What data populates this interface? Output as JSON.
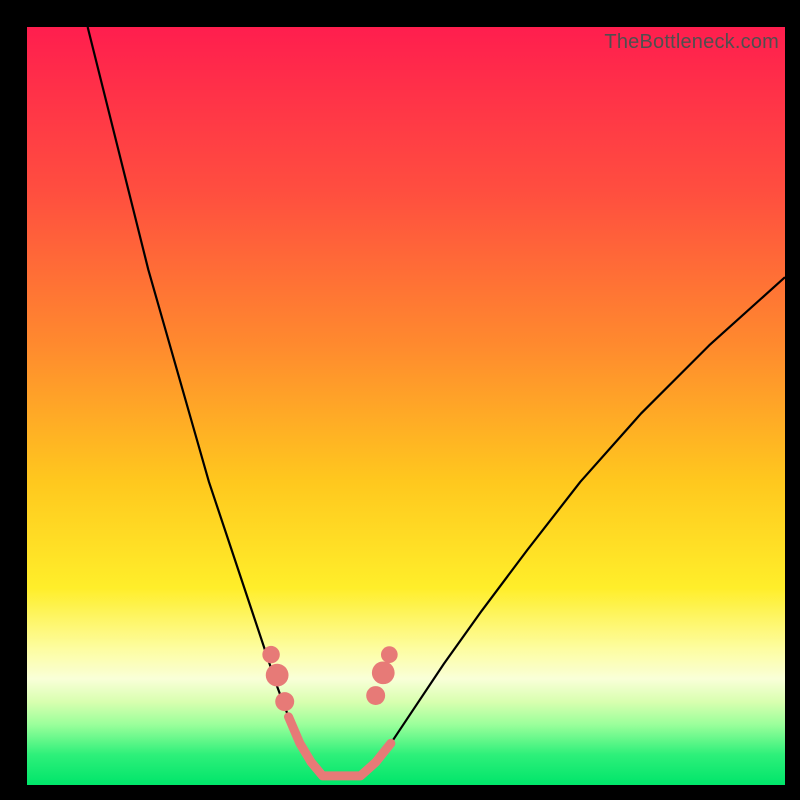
{
  "watermark": {
    "text": "TheBottleneck.com"
  },
  "chart_data": {
    "type": "line",
    "title": "",
    "xlabel": "",
    "ylabel": "",
    "xlim": [
      0,
      100
    ],
    "ylim": [
      0,
      100
    ],
    "grid": false,
    "gradient_stops": [
      {
        "offset": 0,
        "color": "#ff1e4e"
      },
      {
        "offset": 0.22,
        "color": "#ff4f3f"
      },
      {
        "offset": 0.42,
        "color": "#ff8a2e"
      },
      {
        "offset": 0.6,
        "color": "#ffc81e"
      },
      {
        "offset": 0.74,
        "color": "#ffee2a"
      },
      {
        "offset": 0.82,
        "color": "#fdfda0"
      },
      {
        "offset": 0.86,
        "color": "#f9ffd8"
      },
      {
        "offset": 0.89,
        "color": "#d9ffb0"
      },
      {
        "offset": 0.92,
        "color": "#9bff9b"
      },
      {
        "offset": 0.96,
        "color": "#2ef07a"
      },
      {
        "offset": 1.0,
        "color": "#00e56a"
      }
    ],
    "series": [
      {
        "name": "left-branch",
        "color": "#000000",
        "stroke_width": 2.2,
        "x": [
          8,
          10,
          12,
          14,
          16,
          18,
          20,
          22,
          24,
          26,
          28,
          30,
          31.5,
          33,
          34.5,
          36,
          37.5,
          39
        ],
        "y": [
          100,
          92,
          84,
          76,
          68,
          61,
          54,
          47,
          40,
          34,
          28,
          22,
          17.5,
          13,
          9,
          5.5,
          3,
          1.2
        ]
      },
      {
        "name": "right-branch",
        "color": "#000000",
        "stroke_width": 2.2,
        "x": [
          44,
          46,
          48,
          51,
          55,
          60,
          66,
          73,
          81,
          90,
          100
        ],
        "y": [
          1.2,
          3.0,
          5.5,
          10,
          16,
          23,
          31,
          40,
          49,
          58,
          67
        ]
      },
      {
        "name": "bottom-highlight",
        "color": "#e77a77",
        "stroke_width": 9,
        "linecap": "round",
        "x": [
          34.5,
          36,
          37.5,
          39,
          41.5,
          44,
          46,
          48
        ],
        "y": [
          9,
          5.5,
          3,
          1.2,
          1.2,
          1.2,
          3.0,
          5.5
        ]
      }
    ],
    "markers": [
      {
        "cx": 34.0,
        "cy": 11.0,
        "r": 1.25,
        "color": "#e77a77"
      },
      {
        "cx": 33.0,
        "cy": 14.5,
        "r": 1.5,
        "color": "#e77a77"
      },
      {
        "cx": 32.2,
        "cy": 17.2,
        "r": 1.15,
        "color": "#e77a77"
      },
      {
        "cx": 46.0,
        "cy": 11.8,
        "r": 1.25,
        "color": "#e77a77"
      },
      {
        "cx": 47.0,
        "cy": 14.8,
        "r": 1.5,
        "color": "#e77a77"
      },
      {
        "cx": 47.8,
        "cy": 17.2,
        "r": 1.1,
        "color": "#e77a77"
      }
    ]
  }
}
